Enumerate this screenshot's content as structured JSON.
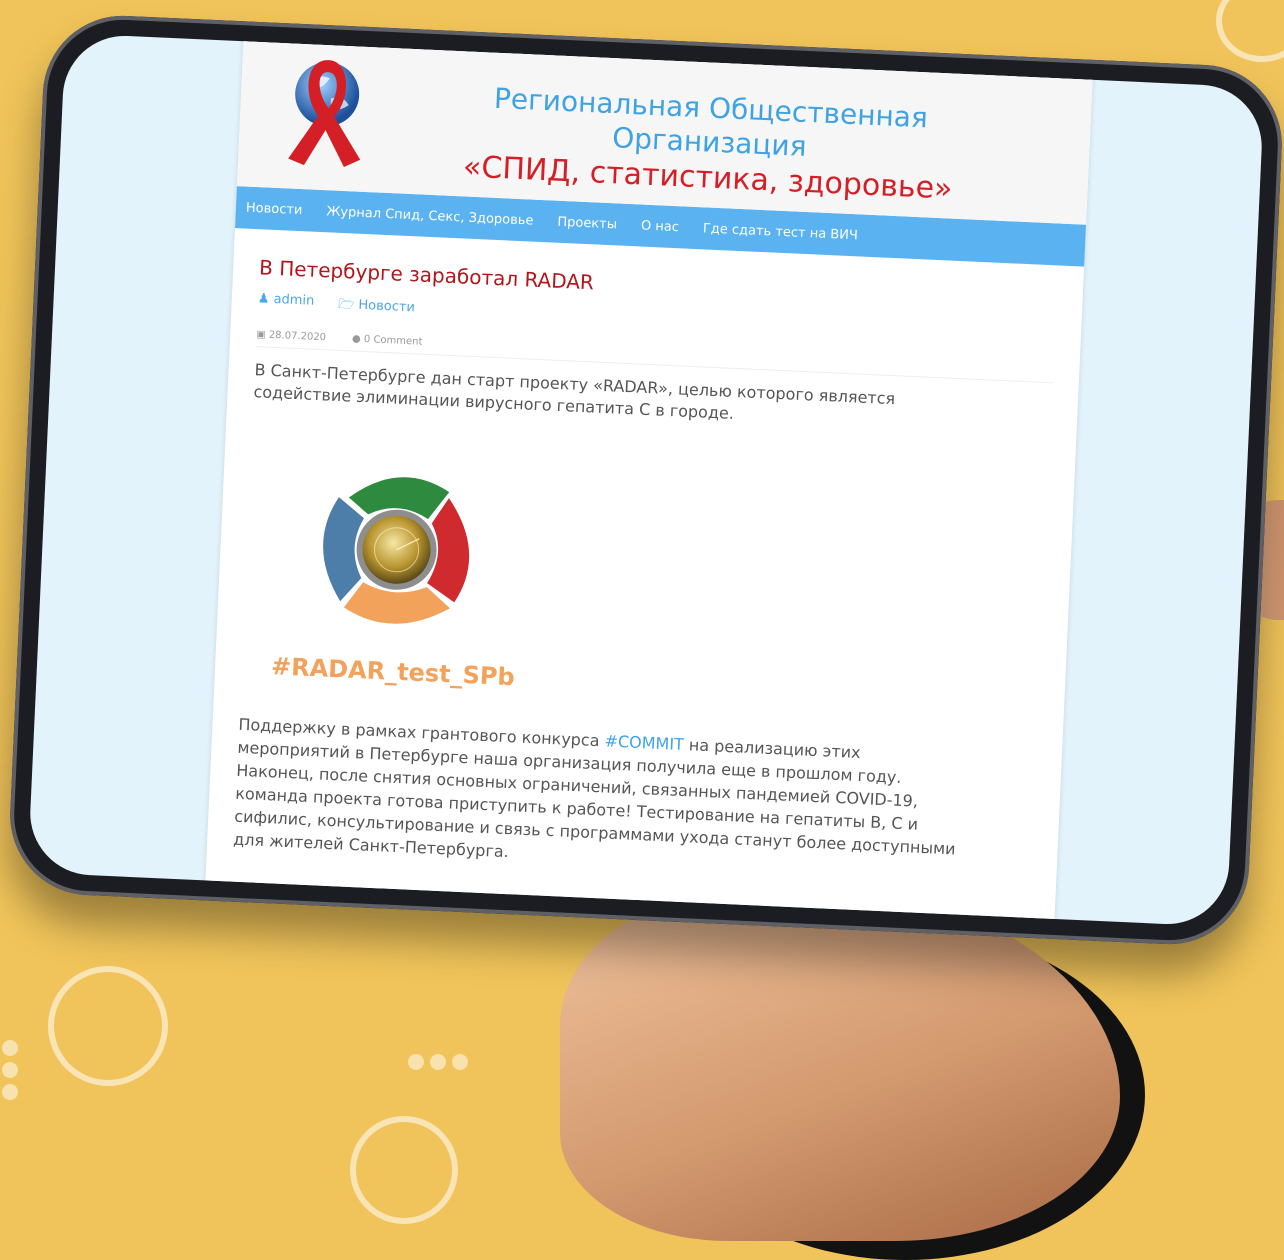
{
  "site": {
    "title_line1": "Региональная Общественная",
    "title_line2": "Организация",
    "title_line3": "«СПИД, статистика, здоровье»"
  },
  "nav": {
    "items": [
      {
        "label": "Новости"
      },
      {
        "label": "Журнал Спид, Секс, Здоровье"
      },
      {
        "label": "Проекты"
      },
      {
        "label": "О нас"
      },
      {
        "label": "Где сдать тест на ВИЧ"
      }
    ]
  },
  "post": {
    "title": "В Петербурге заработал RADAR",
    "author": "admin",
    "category": "Новости",
    "date": "28.07.2020",
    "comments": "0 Comment",
    "intro": "В Санкт-Петербурге дан старт проекту «RADAR», целью которого является содействие элиминации вирусного гепатита С в городе.",
    "image_tag": "#RADAR_test_SPb",
    "body_before_link": "Поддержку в рамках грантового конкурса ",
    "body_link": "#COMMIT",
    "body_after_link": " на реализацию этих мероприятий в Петербурге наша организация получила еще в прошлом году. Наконец, после снятия основных ограничений, связанных пандемией COVID-19, команда проекта готова приступить к работе! Тестирование на гепатиты В, С и сифилис, консультирование и связь с программами ухода станут более доступными для жителей Санкт-Петербурга."
  },
  "icons": {
    "author": "user-icon",
    "category": "folder-icon",
    "date": "calendar-icon",
    "comments": "comment-icon"
  },
  "colors": {
    "accent_blue": "#4aa8ea",
    "title_red": "#d51f26",
    "background_yellow": "#f0c45a"
  }
}
